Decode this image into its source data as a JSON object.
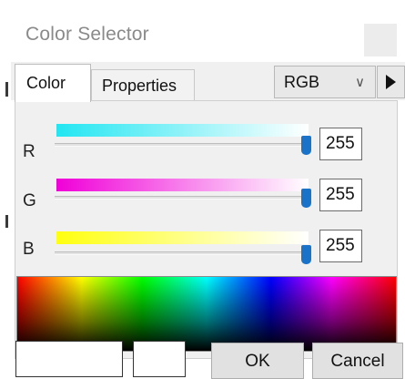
{
  "window": {
    "title": "Color Selector"
  },
  "tabs": [
    {
      "label": "Color",
      "active": true
    },
    {
      "label": "Properties",
      "active": false
    }
  ],
  "mode_select": {
    "value": "RGB"
  },
  "channels": [
    {
      "label": "R",
      "value": "255",
      "level": 1.0,
      "color": "#22e6f2"
    },
    {
      "label": "G",
      "value": "255",
      "level": 1.0,
      "color": "#f000d8"
    },
    {
      "label": "B",
      "value": "255",
      "level": 1.0,
      "color": "#ffff10"
    }
  ],
  "buttons": {
    "ok": "OK",
    "cancel": "Cancel"
  },
  "icons": {
    "close": "close-icon",
    "dropdown": "chevron-down-icon",
    "next": "play-triangle-icon"
  },
  "colors": {
    "slider_thumb": "#1a73c9",
    "panel_bg": "#f0f0f0"
  }
}
